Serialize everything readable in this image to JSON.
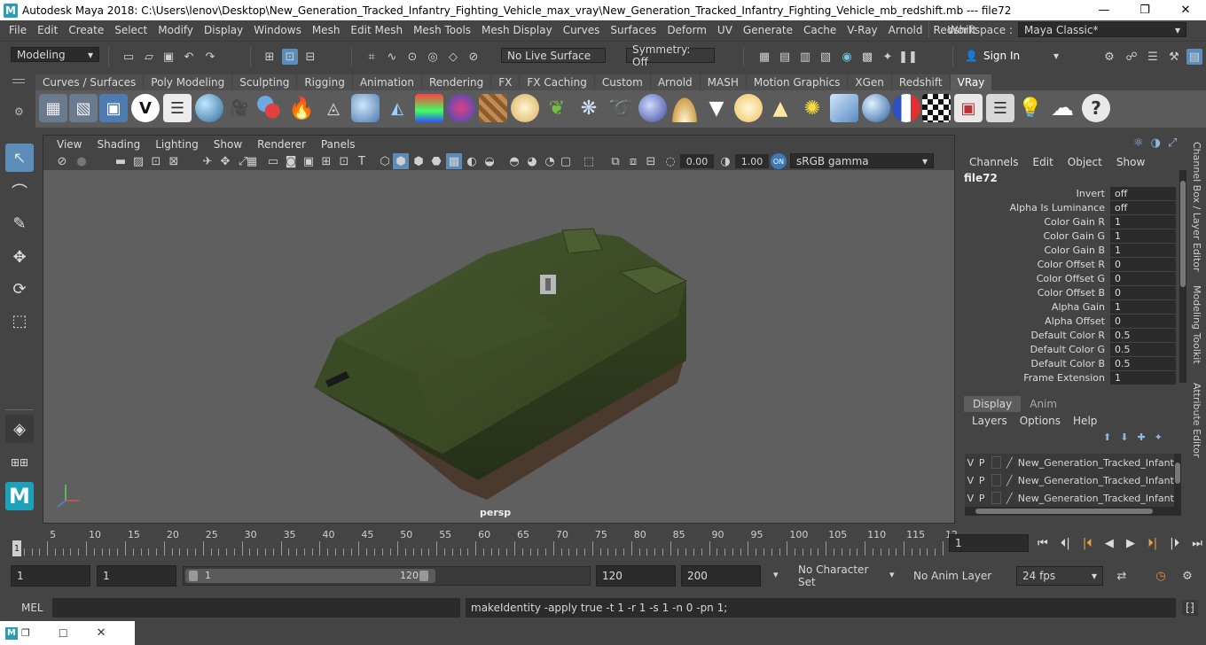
{
  "window": {
    "title": "Autodesk Maya 2018: C:\\Users\\lenov\\Desktop\\New_Generation_Tracked_Infantry_Fighting_Vehicle_max_vray\\New_Generation_Tracked_Infantry_Fighting_Vehicle_mb_redshift.mb   ---   file72",
    "minimize": "—",
    "maximize": "❐",
    "close": "✕"
  },
  "menubar": {
    "items": [
      "File",
      "Edit",
      "Create",
      "Select",
      "Modify",
      "Display",
      "Windows",
      "Mesh",
      "Edit Mesh",
      "Mesh Tools",
      "Mesh Display",
      "Curves",
      "Surfaces",
      "Deform",
      "UV",
      "Generate",
      "Cache",
      "V-Ray",
      "Arnold",
      "Redshift"
    ],
    "workspace_label": "Workspace :",
    "workspace_value": "Maya Classic*"
  },
  "statusline": {
    "mode": "Modeling",
    "live_surface": "No Live Surface",
    "symmetry": "Symmetry: Off",
    "sign_in": "Sign In"
  },
  "shelf": {
    "tabs": [
      "Curves / Surfaces",
      "Poly Modeling",
      "Sculpting",
      "Rigging",
      "Animation",
      "Rendering",
      "FX",
      "FX Caching",
      "Custom",
      "Arnold",
      "MASH",
      "Motion Graphics",
      "XGen",
      "Redshift",
      "VRay"
    ],
    "active_tab": "VRay"
  },
  "viewport": {
    "menu": [
      "View",
      "Shading",
      "Lighting",
      "Show",
      "Renderer",
      "Panels"
    ],
    "exposure": "0.00",
    "gamma": "1.00",
    "color_space": "sRGB gamma",
    "camera_label": "persp"
  },
  "channelbox": {
    "menu": [
      "Channels",
      "Edit",
      "Object",
      "Show"
    ],
    "node_name": "file72",
    "rows": [
      {
        "label": "Invert",
        "value": "off"
      },
      {
        "label": "Alpha Is Luminance",
        "value": "off"
      },
      {
        "label": "Color Gain R",
        "value": "1"
      },
      {
        "label": "Color Gain G",
        "value": "1"
      },
      {
        "label": "Color Gain B",
        "value": "1"
      },
      {
        "label": "Color Offset R",
        "value": "0"
      },
      {
        "label": "Color Offset G",
        "value": "0"
      },
      {
        "label": "Color Offset B",
        "value": "0"
      },
      {
        "label": "Alpha Gain",
        "value": "1"
      },
      {
        "label": "Alpha Offset",
        "value": "0"
      },
      {
        "label": "Default Color R",
        "value": "0.5"
      },
      {
        "label": "Default Color G",
        "value": "0.5"
      },
      {
        "label": "Default Color B",
        "value": "0.5"
      },
      {
        "label": "Frame Extension",
        "value": "1"
      }
    ],
    "layer_tabs": [
      "Display",
      "Anim"
    ],
    "layer_menu": [
      "Layers",
      "Options",
      "Help"
    ],
    "layers": [
      {
        "v": "V",
        "p": "P",
        "name": "New_Generation_Tracked_Infantry_"
      },
      {
        "v": "V",
        "p": "P",
        "name": "New_Generation_Tracked_Infantry_"
      },
      {
        "v": "V",
        "p": "P",
        "name": "New_Generation_Tracked_Infantry_"
      }
    ]
  },
  "side_tabs": [
    "Channel Box / Layer Editor",
    "Modeling Toolkit",
    "Attribute Editor"
  ],
  "timeslider": {
    "ticks": [
      "5",
      "10",
      "15",
      "20",
      "25",
      "30",
      "35",
      "40",
      "45",
      "50",
      "55",
      "60",
      "65",
      "70",
      "75",
      "80",
      "85",
      "90",
      "95",
      "100",
      "105",
      "110",
      "115",
      "12"
    ],
    "current_marker": "1",
    "current_frame": "1"
  },
  "range": {
    "start": "1",
    "playback_start": "1",
    "range_start_label": "1",
    "range_end_label": "120",
    "playback_end": "120",
    "end": "200",
    "character_set": "No Character Set",
    "anim_layer": "No Anim Layer",
    "fps": "24 fps"
  },
  "commandline": {
    "language": "MEL",
    "result": "makeIdentity -apply true -t 1 -r 1 -s 1 -n 0 -pn 1;"
  }
}
